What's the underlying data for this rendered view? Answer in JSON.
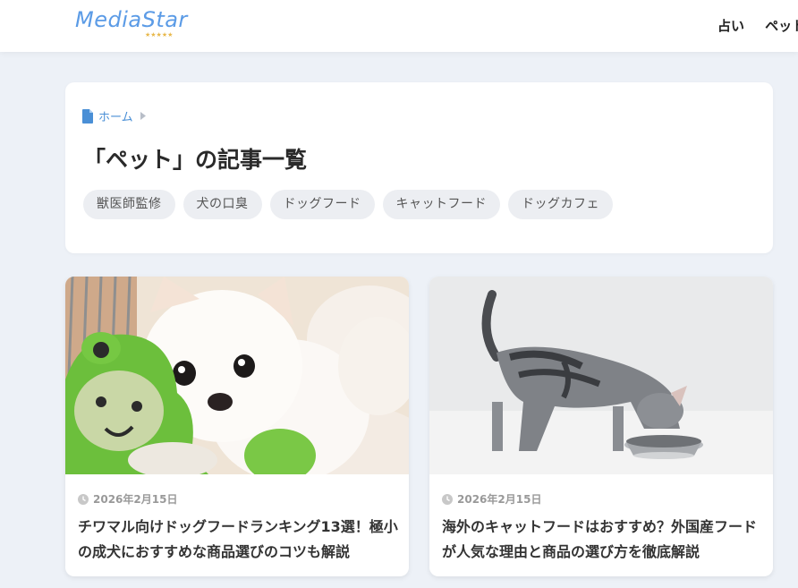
{
  "header": {
    "logo_text": "MediaStar",
    "logo_stars": "★★★★★",
    "nav": [
      "占い",
      "ペット"
    ]
  },
  "breadcrumb": {
    "home": "ホーム"
  },
  "archive": {
    "title": "「ペット」の記事一覧",
    "tags": [
      "獣医師監修",
      "犬の口臭",
      "ドッグフード",
      "キャットフード",
      "ドッグカフェ"
    ]
  },
  "cards": [
    {
      "date": "2026年2月15日",
      "title": "チワマル向けドッグフードランキング13選！極小の成犬におすすめな商品選びのコツも解説",
      "image": "white-puppy-with-green-frog-plush"
    },
    {
      "date": "2026年2月15日",
      "title": "海外のキャットフードはおすすめ？外国産フードが人気な理由と商品の選び方を徹底解説",
      "image": "tabby-kitten-eating-from-steel-bowl"
    }
  ],
  "colors": {
    "accent": "#4a8fd6",
    "logo": "#5b9be6",
    "background": "#edf1f7",
    "tag_bg": "#eceef2"
  }
}
